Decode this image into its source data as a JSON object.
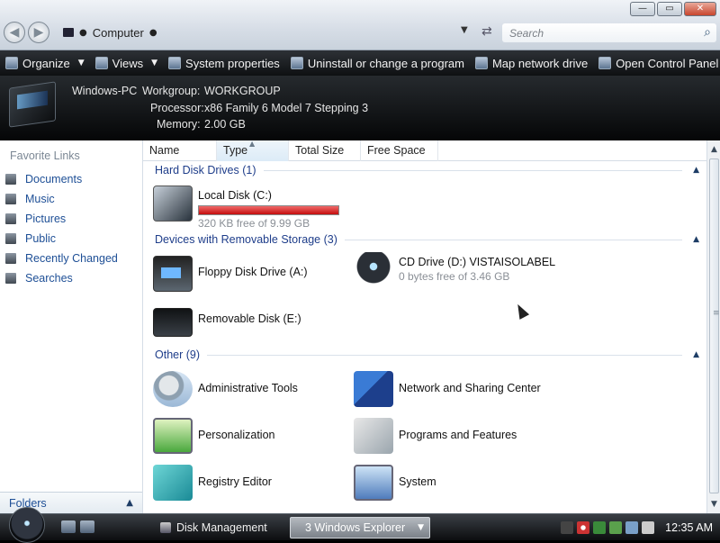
{
  "window": {
    "minimize": "—",
    "maximize": "▭",
    "close": "✕"
  },
  "address": {
    "location": "Computer",
    "separator": "●",
    "search_placeholder": "Search"
  },
  "toolbar": {
    "organize": "Organize",
    "views": "Views",
    "system_properties": "System properties",
    "uninstall": "Uninstall or change a program",
    "map_drive": "Map network drive",
    "control_panel": "Open Control Panel"
  },
  "details": {
    "pc_name": "Windows-PC",
    "workgroup_label": "Workgroup:",
    "workgroup_value": "WORKGROUP",
    "processor_label": "Processor:",
    "processor_value": "x86 Family 6 Model 7 Stepping 3",
    "memory_label": "Memory:",
    "memory_value": "2.00 GB"
  },
  "nav": {
    "header": "Favorite Links",
    "links": [
      "Documents",
      "Music",
      "Pictures",
      "Public",
      "Recently Changed",
      "Searches"
    ],
    "folders_label": "Folders"
  },
  "columns": [
    "Name",
    "Type",
    "Total Size",
    "Free Space"
  ],
  "groups": {
    "hard_disk": "Hard Disk Drives (1)",
    "removable": "Devices with Removable Storage (3)",
    "other": "Other (9)"
  },
  "items": {
    "local_disk": {
      "name": "Local Disk (C:)",
      "detail": "320 KB free of 9.99 GB",
      "used_fraction": 0.9997
    },
    "floppy": {
      "name": "Floppy Disk Drive (A:)"
    },
    "cd": {
      "name": "CD Drive (D:) VISTAISOLABEL",
      "detail": "0 bytes free of 3.46 GB"
    },
    "removable": {
      "name": "Removable Disk (E:)"
    },
    "admin_tools": {
      "name": "Administrative Tools"
    },
    "network_center": {
      "name": "Network and Sharing Center"
    },
    "personalization": {
      "name": "Personalization"
    },
    "programs": {
      "name": "Programs and Features"
    },
    "registry": {
      "name": "Registry Editor"
    },
    "system": {
      "name": "System"
    }
  },
  "taskbar": {
    "disk_management": "Disk Management",
    "explorer": "3 Windows Explorer",
    "clock": "12:35 AM"
  },
  "colors": {
    "accent_link": "#1e4f96",
    "usage_bar": "#c40d0d"
  }
}
